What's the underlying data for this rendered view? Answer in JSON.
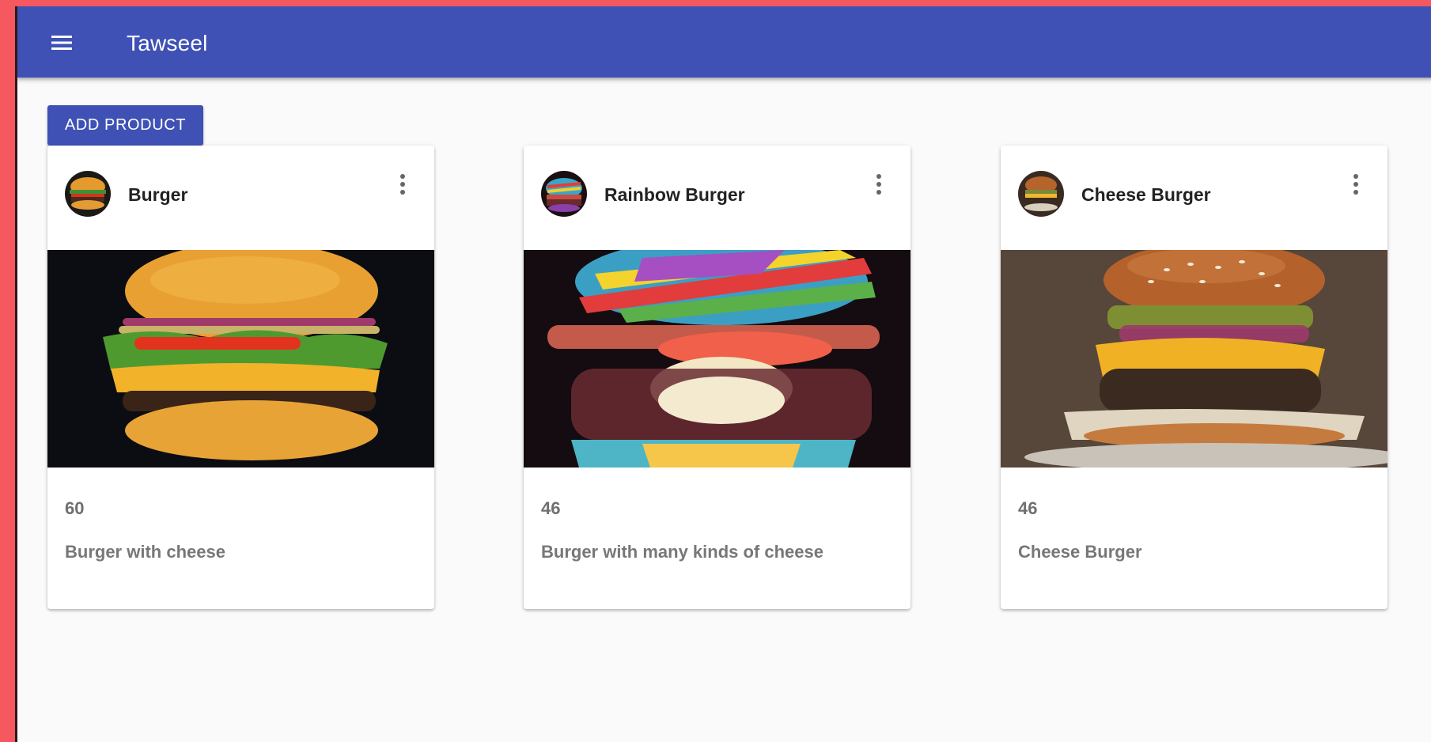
{
  "app": {
    "title": "Tawseel"
  },
  "toolbar": {
    "add_label": "ADD PRODUCT"
  },
  "products": [
    {
      "name": "Burger",
      "price": "60",
      "description": "Burger with cheese"
    },
    {
      "name": "Rainbow Burger",
      "price": "46",
      "description": "Burger with many kinds of cheese"
    },
    {
      "name": "Cheese Burger",
      "price": "46",
      "description": "Cheese Burger"
    }
  ],
  "colors": {
    "primary": "#3f51b5",
    "background": "#fafafa",
    "outer_frame": "#f5585f"
  },
  "icons": {
    "menu": "menu-icon",
    "more": "more-vert-icon"
  }
}
